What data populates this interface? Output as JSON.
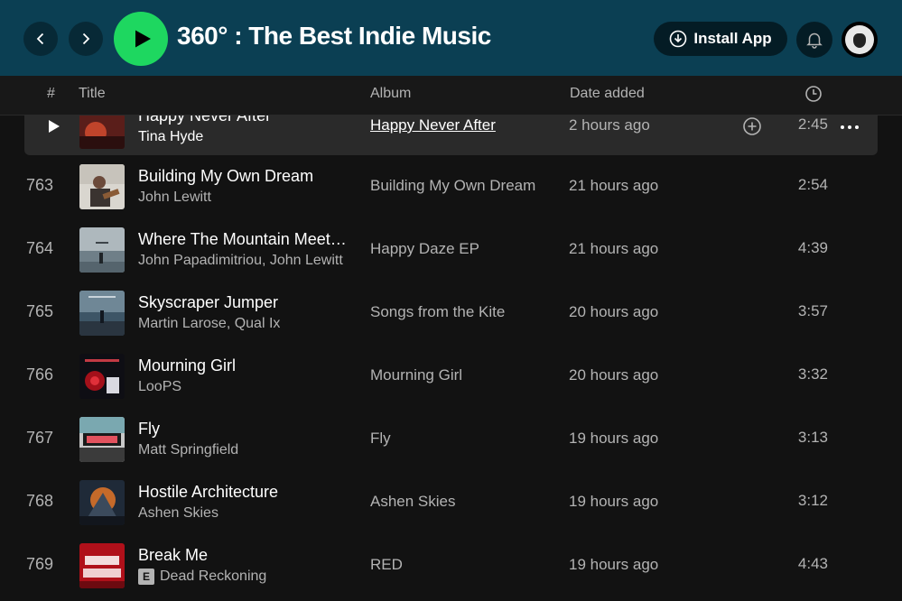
{
  "header": {
    "title": "360° : The Best Indie Music",
    "install_label": "Install App",
    "accent_green": "#1ed760",
    "header_bg": "#0b3f53"
  },
  "columns": {
    "number": "#",
    "title": "Title",
    "album": "Album",
    "date_added": "Date added",
    "duration_icon": "clock-icon"
  },
  "tracks": [
    {
      "number": "",
      "title": "Happy Never After",
      "artist": "Tina Hyde",
      "album": "Happy Never After",
      "date_added": "2 hours ago",
      "duration": "2:45",
      "active": true,
      "explicit": false
    },
    {
      "number": "763",
      "title": "Building My Own Dream",
      "artist": "John Lewitt",
      "album": "Building My Own Dream",
      "date_added": "21 hours ago",
      "duration": "2:54",
      "explicit": false
    },
    {
      "number": "764",
      "title": "Where The Mountain Meets The Sea",
      "artist": "John Papadimitriou, John Lewitt",
      "album": "Happy Daze EP",
      "date_added": "21 hours ago",
      "duration": "4:39",
      "explicit": false
    },
    {
      "number": "765",
      "title": "Skyscraper Jumper",
      "artist": "Martin Larose, Qual Ix",
      "album": "Songs from the Kite",
      "date_added": "20 hours ago",
      "duration": "3:57",
      "explicit": false
    },
    {
      "number": "766",
      "title": "Mourning Girl",
      "artist": "LooPS",
      "album": "Mourning Girl",
      "date_added": "20 hours ago",
      "duration": "3:32",
      "explicit": false
    },
    {
      "number": "767",
      "title": "Fly",
      "artist": "Matt Springfield",
      "album": "Fly",
      "date_added": "19 hours ago",
      "duration": "3:13",
      "explicit": false
    },
    {
      "number": "768",
      "title": "Hostile Architecture",
      "artist": "Ashen Skies",
      "album": "Ashen Skies",
      "date_added": "19 hours ago",
      "duration": "3:12",
      "explicit": false
    },
    {
      "number": "769",
      "title": "Break Me",
      "artist": "Dead Reckoning",
      "album": "RED",
      "date_added": "19 hours ago",
      "duration": "4:43",
      "explicit": true,
      "explicit_label": "E"
    }
  ]
}
